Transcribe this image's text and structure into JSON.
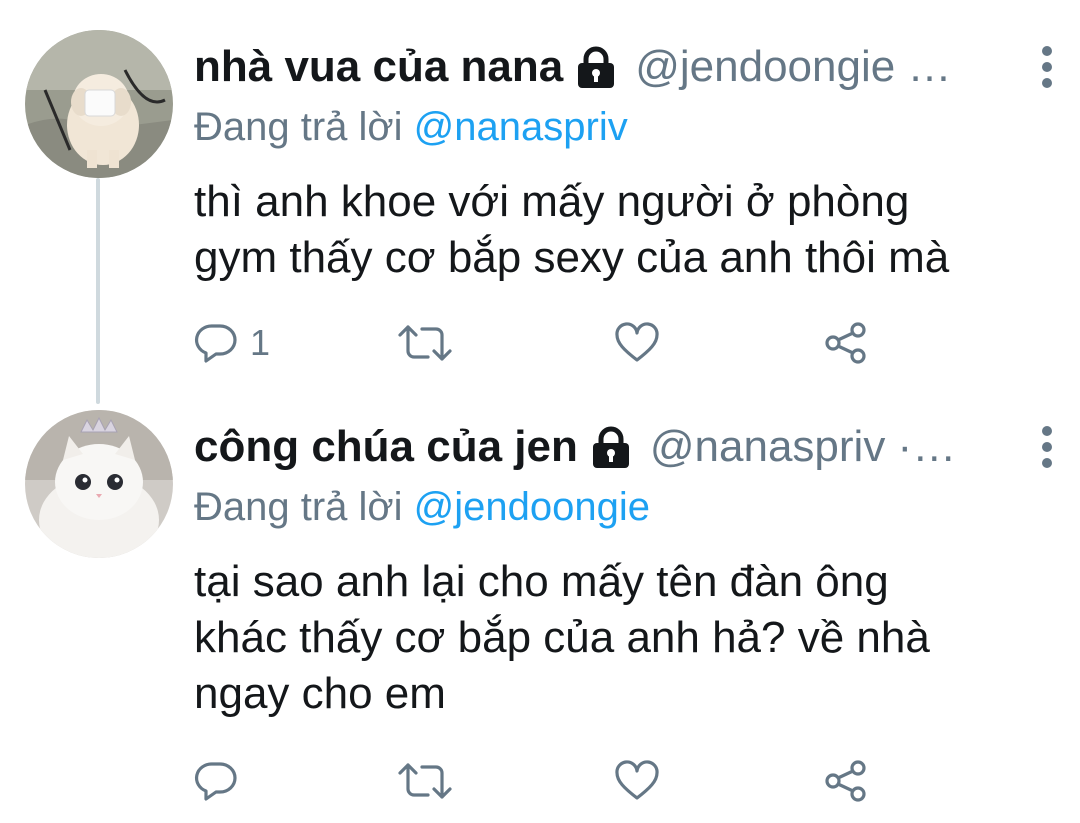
{
  "tweets": [
    {
      "display_name": "nhà vua của nana",
      "handle": "@jendoongie …",
      "replying_prefix": "Đang trả lời",
      "replying_to": "@nanaspriv",
      "text_lines": [
        "thì anh khoe với mấy người ở phòng",
        "gym thấy cơ bắp sexy của anh thôi mà"
      ],
      "reply_count": "1",
      "avatar": "fluffy-dog-with-cup-on-head",
      "protected": true
    },
    {
      "display_name": "công chúa của jen",
      "handle": "@nanaspriv ·…",
      "replying_prefix": "Đang trả lời",
      "replying_to": "@jendoongie",
      "text_lines": [
        "tại sao anh lại cho mấy tên đàn ông",
        "khác thấy cơ bắp của anh hả? về nhà",
        "ngay cho em"
      ],
      "reply_count": "",
      "avatar": "white-cat-with-crown",
      "protected": true
    }
  ],
  "icons": {
    "lock": "lock-icon",
    "more": "more-vertical-icon",
    "reply": "reply-icon",
    "retweet": "retweet-icon",
    "like": "heart-icon",
    "share": "share-icon"
  },
  "colors": {
    "text": "#14171a",
    "secondary": "#657786",
    "link": "#1da1f2",
    "thread_line": "#cfd9de"
  }
}
